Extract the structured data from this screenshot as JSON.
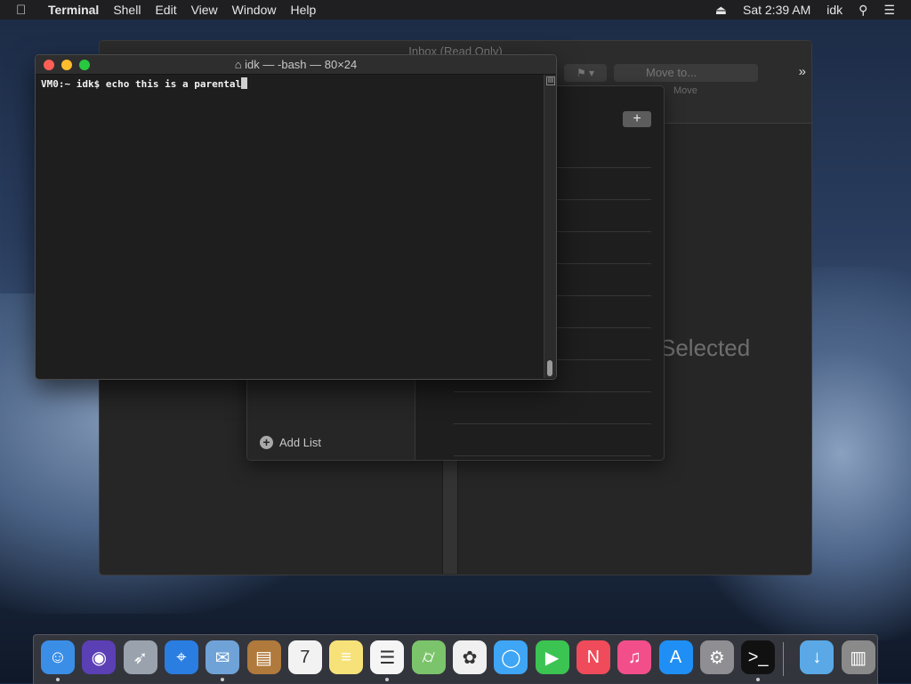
{
  "menubar": {
    "apple_icon": "apple-icon",
    "app_name": "Terminal",
    "items": [
      "Shell",
      "Edit",
      "View",
      "Window",
      "Help"
    ],
    "time": "Sat 2:39 AM",
    "user": "idk"
  },
  "mail": {
    "title": "Inbox (Read Only)",
    "move_to": "Move to...",
    "move_label": "Move",
    "selected_text": "Selected"
  },
  "reminders": {
    "add_list": "Add List",
    "add_button": "+"
  },
  "terminal": {
    "title": "idk — -bash — 80×24",
    "prompt": "VM0:~ idk$ ",
    "command": "echo this is a parental"
  },
  "dock": {
    "apps": [
      {
        "name": "Finder",
        "icon": "finder-icon",
        "color": "#3a8ee6",
        "running": true
      },
      {
        "name": "Siri",
        "icon": "siri-icon",
        "color": "#5b3fb5",
        "running": false
      },
      {
        "name": "Launchpad",
        "icon": "launchpad-icon",
        "color": "#9aa3ad",
        "running": false
      },
      {
        "name": "Safari",
        "icon": "safari-icon",
        "color": "#2a7de1",
        "running": false
      },
      {
        "name": "Mail",
        "icon": "mail-icon",
        "color": "#6fa3d8",
        "running": true
      },
      {
        "name": "Contacts",
        "icon": "contacts-icon",
        "color": "#b07a3c",
        "running": false
      },
      {
        "name": "Calendar",
        "icon": "calendar-icon",
        "color": "#f2f2f2",
        "running": false
      },
      {
        "name": "Notes",
        "icon": "notes-icon",
        "color": "#f7e27a",
        "running": false
      },
      {
        "name": "Reminders",
        "icon": "reminders-icon",
        "color": "#f5f5f5",
        "running": true
      },
      {
        "name": "Maps",
        "icon": "maps-icon",
        "color": "#7cc46b",
        "running": false
      },
      {
        "name": "Photos",
        "icon": "photos-icon",
        "color": "#f0f0f0",
        "running": false
      },
      {
        "name": "Messages",
        "icon": "messages-icon",
        "color": "#3fa5f5",
        "running": false
      },
      {
        "name": "FaceTime",
        "icon": "facetime-icon",
        "color": "#3bc452",
        "running": false
      },
      {
        "name": "News",
        "icon": "news-icon",
        "color": "#f04b5a",
        "running": false
      },
      {
        "name": "iTunes",
        "icon": "itunes-icon",
        "color": "#f24f8a",
        "running": false
      },
      {
        "name": "App Store",
        "icon": "appstore-icon",
        "color": "#1f8ff5",
        "running": false
      },
      {
        "name": "System Preferences",
        "icon": "system-preferences-icon",
        "color": "#8e8e93",
        "running": false
      },
      {
        "name": "Terminal",
        "icon": "terminal-icon",
        "color": "#111111",
        "running": true
      },
      {
        "name": "Downloads",
        "icon": "downloads-icon",
        "color": "#5aa9e6",
        "running": false
      },
      {
        "name": "Trash",
        "icon": "trash-icon",
        "color": "#8a8a8a",
        "running": false
      }
    ]
  },
  "colors": {
    "close": "#ff5f57",
    "minimize": "#febc2e",
    "zoom": "#28c840"
  }
}
